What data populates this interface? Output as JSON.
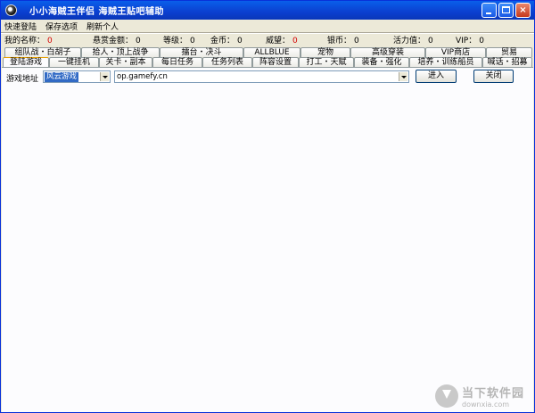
{
  "window": {
    "title": "小小海贼王伴侣  海贼王贴吧辅助",
    "close_glyph": "×"
  },
  "menu": [
    "快速登陆",
    "保存选项",
    "刷新个人"
  ],
  "status": [
    {
      "label": "我的名称：",
      "value": "0",
      "color": "#d40000"
    },
    {
      "label": "悬赏金额：",
      "value": "0"
    },
    {
      "label": "等级：",
      "value": "0"
    },
    {
      "label": "金币：",
      "value": "0"
    },
    {
      "label": "威望：",
      "value": "0",
      "color": "#d40000"
    },
    {
      "label": "银币：",
      "value": "0"
    },
    {
      "label": "活力值：",
      "value": "0"
    },
    {
      "label": "VIP：",
      "value": "0"
    }
  ],
  "tabs": {
    "row1": [
      "组队战・白胡子",
      "拾人・顶上战争",
      "擂台・决斗",
      "ALLBLUE",
      "宠物",
      "高级穿装",
      "VIP商店",
      "贸易"
    ],
    "row2": [
      "登陆游戏",
      "一键挂机",
      "关卡・副本",
      "每日任务",
      "任务列表",
      "阵容设置",
      "打工・天赋",
      "装备・强化",
      "培养・训练船员",
      "喊话・招募"
    ],
    "active": "登陆游戏"
  },
  "addressbar": {
    "label": "游戏地址",
    "server_selected": "风云游戏",
    "url_value": "op.gamefy.cn",
    "enter_label": "进入",
    "close_label": "关闭"
  },
  "watermark": {
    "name": "当下软件园",
    "url": "downxia.com"
  }
}
